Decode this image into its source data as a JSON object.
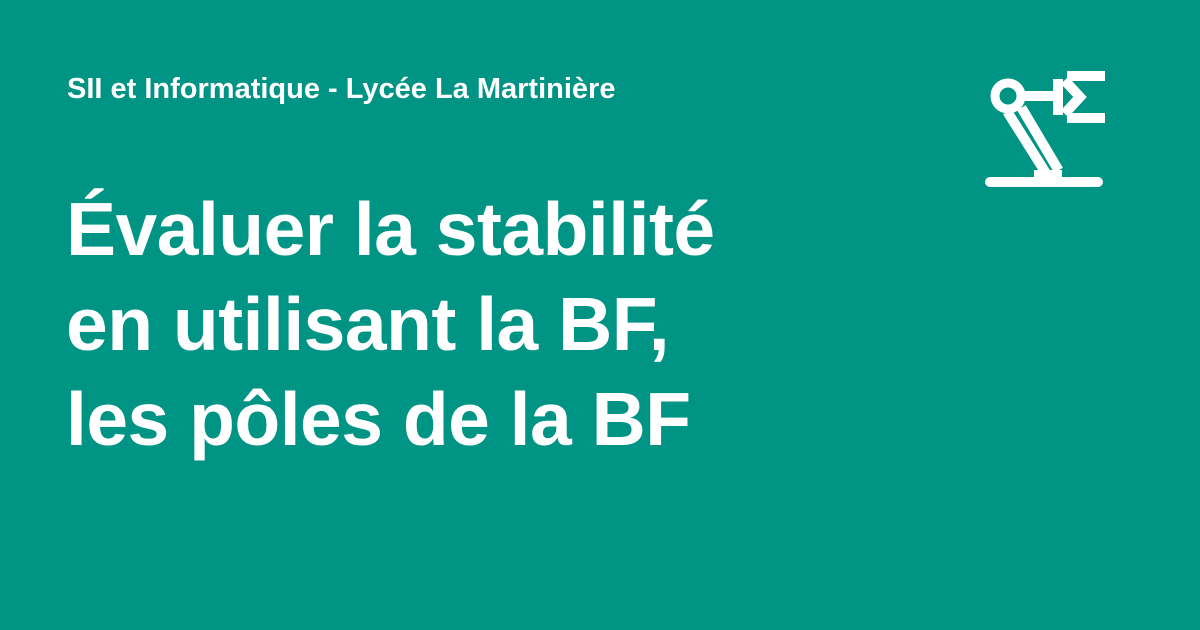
{
  "site": {
    "name": "SII et Informatique - Lycée La Martinière"
  },
  "page": {
    "title_lines": [
      "Évaluer la stabilité",
      "en utilisant la BF,",
      "les pôles de la BF"
    ]
  },
  "logo": {
    "icon": "robot-arm-icon"
  },
  "colors": {
    "background": "#009485",
    "foreground": "#ffffff"
  }
}
